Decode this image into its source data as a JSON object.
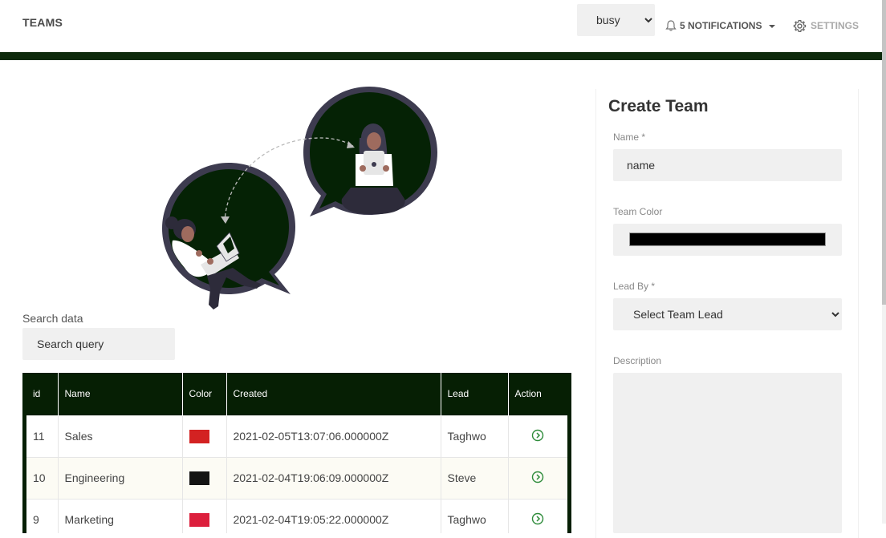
{
  "navbar": {
    "brand": "TEAMS",
    "status_value": "busy",
    "notifications_label": "5 NOTIFICATIONS",
    "settings_label": "SETTINGS"
  },
  "search": {
    "label": "Search data",
    "placeholder": "Search query"
  },
  "table": {
    "headers": [
      "id",
      "Name",
      "Color",
      "Created",
      "Lead",
      "Action"
    ],
    "rows": [
      {
        "id": "11",
        "name": "Sales",
        "color": "#d32222",
        "created": "2021-02-05T13:07:06.000000Z",
        "lead": "Taghwo"
      },
      {
        "id": "10",
        "name": "Engineering",
        "color": "#141414",
        "created": "2021-02-04T19:06:09.000000Z",
        "lead": "Steve"
      },
      {
        "id": "9",
        "name": "Marketing",
        "color": "#dc1f3c",
        "created": "2021-02-04T19:05:22.000000Z",
        "lead": "Taghwo"
      }
    ]
  },
  "create_team": {
    "title": "Create Team",
    "name_label": "Name *",
    "name_value": "name",
    "color_label": "Team Color",
    "color_value": "#000000",
    "lead_label": "Lead By *",
    "lead_value": "Select Team Lead",
    "description_label": "Description"
  },
  "colors": {
    "accent_dark_green": "#0e2a0c",
    "action_icon_green": "#2e8b3a"
  }
}
